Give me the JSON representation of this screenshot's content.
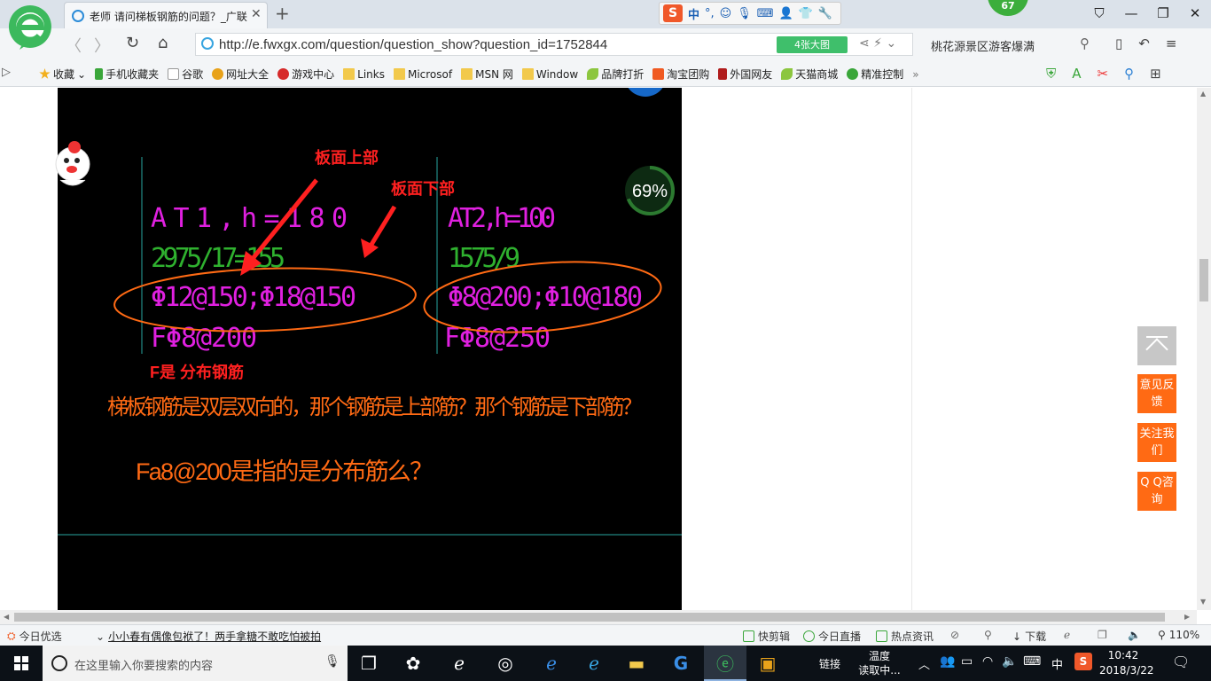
{
  "browser": {
    "tab_title": "老师 请问梯板钢筋的问题？_广联",
    "tab_close": "✕",
    "new_tab": "+",
    "sogou": {
      "letter": "S",
      "zh": "中",
      "punct": "°,"
    },
    "weather_badge": "67",
    "window_buttons": {
      "min": "—",
      "max": "❐",
      "close": "✕",
      "skin": "⛉"
    }
  },
  "addressbar": {
    "url": "http://e.fwxgx.com/question/question_show?question_id=1752844",
    "big_pic_button": "4张大图",
    "search_text": "桃花源景区游客爆满"
  },
  "bookmarks": [
    {
      "label": "收藏",
      "icon": "star-icon",
      "color": "#f2b01e"
    },
    {
      "label": "手机收藏夹",
      "icon": "phone-icon",
      "color": "#3aa63a"
    },
    {
      "label": "谷歌",
      "icon": "page-icon",
      "color": "#dddddd"
    },
    {
      "label": "网址大全",
      "icon": "globe-icon",
      "color": "#e8a21a"
    },
    {
      "label": "游戏中心",
      "icon": "game-icon",
      "color": "#d62a2a"
    },
    {
      "label": "Links",
      "icon": "folder-icon",
      "color": "#f2c94c"
    },
    {
      "label": "Microsof",
      "icon": "folder-icon",
      "color": "#f2c94c"
    },
    {
      "label": "MSN 网",
      "icon": "folder-icon",
      "color": "#f2c94c"
    },
    {
      "label": "Window",
      "icon": "folder-icon",
      "color": "#f2c94c"
    },
    {
      "label": "品牌打折",
      "icon": "leaf-icon",
      "color": "#8cc63f"
    },
    {
      "label": "淘宝团购",
      "icon": "taobao-icon",
      "color": "#f05a22"
    },
    {
      "label": "外国网友",
      "icon": "flag-icon",
      "color": "#b01d1d"
    },
    {
      "label": "天猫商城",
      "icon": "leaf-icon",
      "color": "#8cc63f"
    },
    {
      "label": "精准控制",
      "icon": "chat-icon",
      "color": "#3aa63a"
    }
  ],
  "cad": {
    "left_block": {
      "name": "AT1,h=180",
      "dims": "2975/17=155",
      "rebar": "Φ12@150;Φ18@150",
      "dist": "FΦ8@200"
    },
    "right_block": {
      "name": "AT2,h=100",
      "dims": "1575/9",
      "rebar": "Φ8@200;Φ10@180",
      "dist": "FΦ8@250"
    },
    "annotation_top": "板面上部",
    "annotation_bottom": "板面下部",
    "f_note": "F是  分布钢筋",
    "question_line": "梯板钢筋是双层双向的，那个钢筋是上部筋？那个钢筋是下部筋？",
    "question_line2": "Fa8@200是指的是分布筋么？",
    "progress_label": "69%",
    "progress_value": 0.69,
    "colors": {
      "magenta": "#e020e0",
      "green": "#2fb12f",
      "orange": "#ff6a14",
      "red": "#ff2020",
      "teal": "#1b6f6a"
    }
  },
  "side_buttons": {
    "feedback": "意见反馈",
    "follow": "关注我们",
    "qq": "Q Q咨询"
  },
  "statusbar": {
    "today_pick": "今日优选",
    "news": "小小春有偶像包袱了！两手拿糖不敢吃怕被拍",
    "quick_cut": "快剪辑",
    "live": "今日直播",
    "hot": "热点资讯",
    "download": "下载",
    "zoom": "110%"
  },
  "taskbar": {
    "search_placeholder": "在这里输入你要搜索的内容",
    "link_text": "链接",
    "temp_label": "温度",
    "temp_value": "读取中...",
    "ime": "中",
    "time": "10:42",
    "date": "2018/3/22"
  }
}
